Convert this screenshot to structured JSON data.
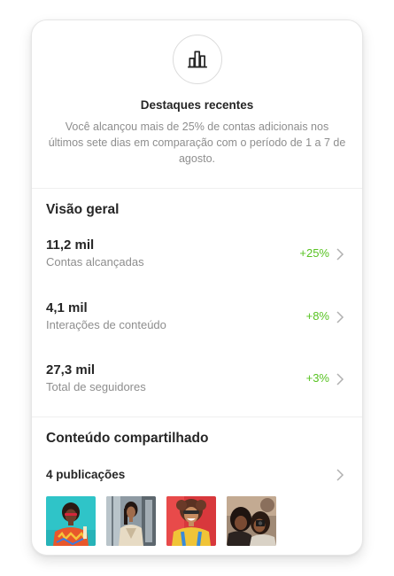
{
  "highlights": {
    "icon": "bar-chart-icon",
    "title": "Destaques recentes",
    "description": "Você alcançou mais de 25% de contas adicionais nos últimos sete dias em comparação com o período de 1 a 7 de agosto."
  },
  "overview": {
    "title": "Visão geral",
    "metrics": [
      {
        "value": "11,2 mil",
        "label": "Contas alcançadas",
        "change": "+25%"
      },
      {
        "value": "4,1 mil",
        "label": "Interações de conteúdo",
        "change": "+8%"
      },
      {
        "value": "27,3 mil",
        "label": "Total de seguidores",
        "change": "+3%"
      }
    ]
  },
  "shared_content": {
    "title": "Conteúdo compartilhado",
    "posts_label": "4 publicações"
  },
  "colors": {
    "positive": "#58c322",
    "muted_text": "#8e8e8e",
    "primary_text": "#262626"
  }
}
